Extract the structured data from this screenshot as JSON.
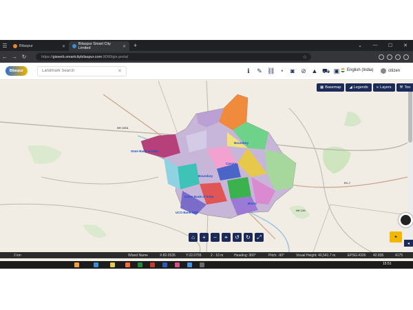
{
  "browser": {
    "tabs": [
      {
        "label": "Bilaspur"
      },
      {
        "label": "Bilaspur Smart City Limited"
      }
    ],
    "url_prefix": "https://",
    "url_host": "gisweb.smartcitybilaspur.com",
    "url_path": ":9090/gis-portal"
  },
  "header": {
    "logo_text": "Bilaspur",
    "search_placeholder": "Landmark Search",
    "language": "English (India)",
    "user": "citizen"
  },
  "layer_buttons": [
    "Basemap",
    "Legends",
    "Layers",
    "Too"
  ],
  "map_labels": {
    "state_bank": "State Bank of India",
    "boundary": "Boundary",
    "boundary2": "Boundary",
    "canara": "Canara",
    "union_bank": "Union Bank of India",
    "ucs_bank": "UCO Bank ATM",
    "bhent": "Bhent",
    "road1": "NH 130A",
    "road2": "NH 130",
    "road3": "EC-7"
  },
  "status": {
    "scale": "2 km",
    "world_name": "Wland Name",
    "x": "X:82.0535",
    "y": "Y:22.0755",
    "zoom_range": "2 - 10 m",
    "heading": "Heading: 360°",
    "pitch": "Pitch: -90°",
    "visual_height": "Visual Height: 40,541.7 m",
    "epsg": "EPSG:4326",
    "lat": "42.835",
    "lon": "4175"
  },
  "taskbar": {
    "time": "15:51"
  }
}
